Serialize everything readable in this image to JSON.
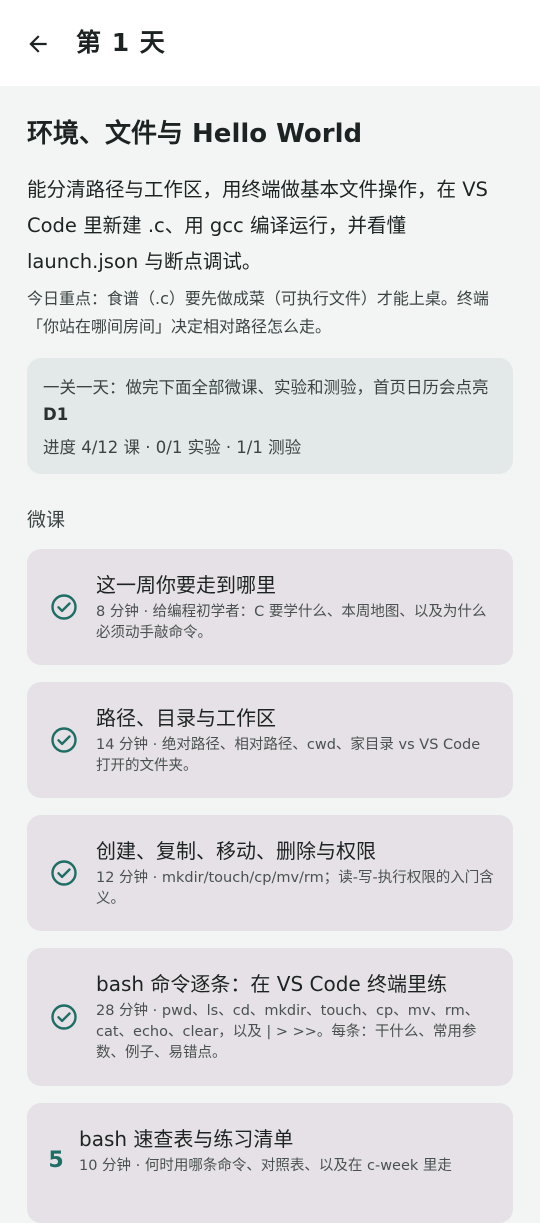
{
  "appbar": {
    "title": "第 1 天",
    "back_icon": "arrow-left-icon"
  },
  "heading": "环境、文件与 Hello World",
  "description": "能分清路径与工作区，用终端做基本文件操作，在 VS Code 里新建 .c、用 gcc 编译运行，并看懂 launch.json 与断点调试。",
  "focus": "今日重点：食谱（.c）要先做成菜（可执行文件）才能上桌。终端「你站在哪间房间」决定相对路径怎么走。",
  "progress": {
    "goal_prefix": "一关一天：做完下面全部微课、实验和测验，首页日历会点亮 ",
    "goal_badge": "D1",
    "stats": "进度 4/12 课 · 0/1 实验 · 1/1 测验"
  },
  "section_label": "微课",
  "colors": {
    "accent": "#1f6e66",
    "card": "#e6e1e6",
    "info_card": "#e3e9e8",
    "background": "#f2f5f4"
  },
  "lessons": [
    {
      "status": "done",
      "icon": "check-circle-icon",
      "title": "这一周你要走到哪里",
      "meta": "8 分钟 · 给编程初学者：C 要学什么、本周地图、以及为什么必须动手敲命令。"
    },
    {
      "status": "done",
      "icon": "check-circle-icon",
      "title": "路径、目录与工作区",
      "meta": "14 分钟 · 绝对路径、相对路径、cwd、家目录 vs VS Code 打开的文件夹。"
    },
    {
      "status": "done",
      "icon": "check-circle-icon",
      "title": "创建、复制、移动、删除与权限",
      "meta": "12 分钟 · mkdir/touch/cp/mv/rm；读-写-执行权限的入门含义。"
    },
    {
      "status": "done",
      "icon": "check-circle-icon",
      "title": "bash 命令逐条：在 VS Code 终端里练",
      "meta": "28 分钟 · pwd、ls、cd、mkdir、touch、cp、mv、rm、cat、echo、clear，以及 | > >>。每条：干什么、常用参数、例子、易错点。"
    },
    {
      "status": "todo",
      "number": "5",
      "title": "bash 速查表与练习清单",
      "meta": "10 分钟 · 何时用哪条命令、对照表、以及在 c-week 里走"
    }
  ]
}
